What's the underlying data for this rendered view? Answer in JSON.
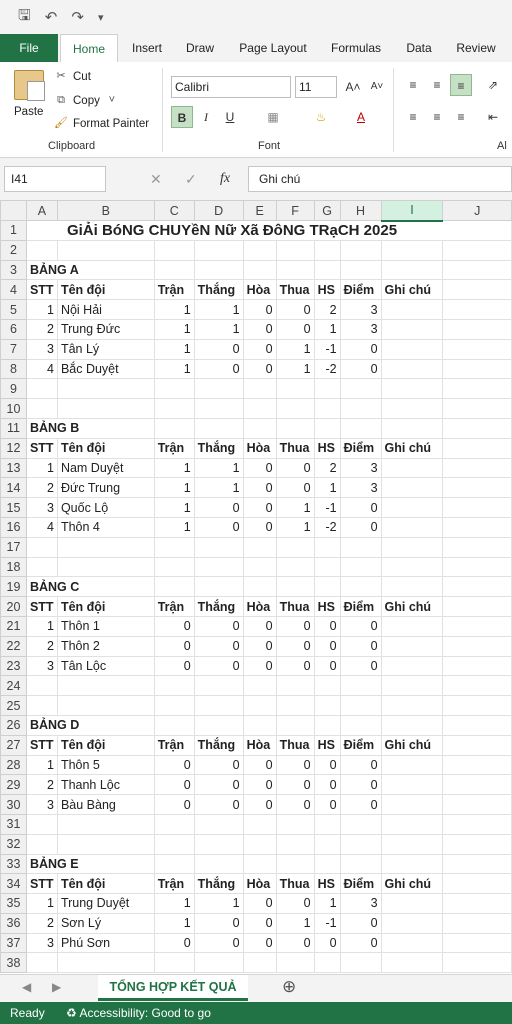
{
  "app": {
    "title": "Excel"
  },
  "tabs": [
    "File",
    "Home",
    "Insert",
    "Draw",
    "Page Layout",
    "Formulas",
    "Data",
    "Review"
  ],
  "ribbon": {
    "paste_label": "Paste",
    "cut_label": "Cut",
    "copy_label": "Copy",
    "format_painter_label": "Format Painter",
    "clipboard_label": "Clipboard",
    "font_name": "Calibri",
    "font_size": "11",
    "font_label": "Font",
    "alignment_label": "Al"
  },
  "formula_bar": {
    "name_box": "I41",
    "formula": "Ghi chú"
  },
  "columns": [
    "A",
    "B",
    "C",
    "D",
    "E",
    "F",
    "G",
    "H",
    "I",
    "J"
  ],
  "sheet": {
    "title": "GIẢI BÓNG CHUYỀN NỮ XÃ ĐÔNG TRẠCH 2025",
    "title_display": "GiẢi BóNG CHUYềN Nữ Xã ĐôNG TRạCH 2025",
    "header": [
      "STT",
      "Tên đội",
      "Trận",
      "Thắng",
      "Hòa",
      "Thua",
      "HS",
      "Điểm",
      "Ghi chú"
    ],
    "groups": [
      {
        "name": "BẢNG A",
        "teams": [
          [
            "1",
            "Nội Hải",
            "1",
            "1",
            "0",
            "0",
            "2",
            "3"
          ],
          [
            "2",
            "Trung Đức",
            "1",
            "1",
            "0",
            "0",
            "1",
            "3"
          ],
          [
            "3",
            "Tân Lý",
            "1",
            "0",
            "0",
            "1",
            "-1",
            "0"
          ],
          [
            "4",
            "Bắc Duyệt",
            "1",
            "0",
            "0",
            "1",
            "-2",
            "0"
          ]
        ]
      },
      {
        "name": "BẢNG B",
        "teams": [
          [
            "1",
            "Nam Duyệt",
            "1",
            "1",
            "0",
            "0",
            "2",
            "3"
          ],
          [
            "2",
            "Đức Trung",
            "1",
            "1",
            "0",
            "0",
            "1",
            "3"
          ],
          [
            "3",
            "Quốc Lộ",
            "1",
            "0",
            "0",
            "1",
            "-1",
            "0"
          ],
          [
            "4",
            "Thôn 4",
            "1",
            "0",
            "0",
            "1",
            "-2",
            "0"
          ]
        ]
      },
      {
        "name": "BẢNG C",
        "teams": [
          [
            "1",
            "Thôn 1",
            "0",
            "0",
            "0",
            "0",
            "0",
            "0"
          ],
          [
            "2",
            "Thôn 2",
            "0",
            "0",
            "0",
            "0",
            "0",
            "0"
          ],
          [
            "3",
            "Tân Lộc",
            "0",
            "0",
            "0",
            "0",
            "0",
            "0"
          ]
        ]
      },
      {
        "name": "BẢNG D",
        "teams": [
          [
            "1",
            "Thôn 5",
            "0",
            "0",
            "0",
            "0",
            "0",
            "0"
          ],
          [
            "2",
            "Thanh Lộc",
            "0",
            "0",
            "0",
            "0",
            "0",
            "0"
          ],
          [
            "3",
            "Bàu Bàng",
            "0",
            "0",
            "0",
            "0",
            "0",
            "0"
          ]
        ]
      },
      {
        "name": "BẢNG E",
        "teams": [
          [
            "1",
            "Trung Duyệt",
            "1",
            "1",
            "0",
            "0",
            "1",
            "3"
          ],
          [
            "2",
            "Sơn Lý",
            "1",
            "0",
            "0",
            "1",
            "-1",
            "0"
          ],
          [
            "3",
            "Phú Sơn",
            "0",
            "0",
            "0",
            "0",
            "0",
            "0"
          ]
        ]
      }
    ]
  },
  "sheet_tab": "TỔNG HỢP KẾT QUẢ",
  "status": {
    "ready": "Ready",
    "accessibility": "Accessibility: Good to go"
  }
}
